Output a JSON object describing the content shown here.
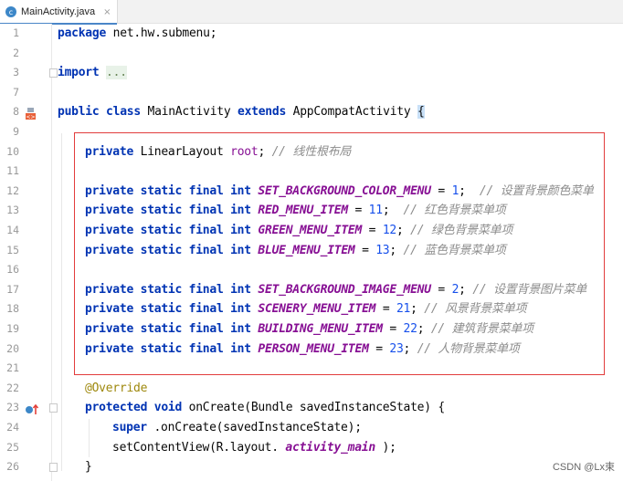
{
  "tab": {
    "icon_letter": "c",
    "filename": "MainActivity.java",
    "close": "×"
  },
  "lines": [
    {
      "n": "1",
      "parts": [
        [
          "kw",
          "package"
        ],
        [
          "",
          "net.hw.submenu;"
        ]
      ]
    },
    {
      "n": "2",
      "parts": []
    },
    {
      "n": "3",
      "parts": [
        [
          "kw",
          "import"
        ],
        [
          "",
          ""
        ],
        [
          "fold",
          "..."
        ]
      ]
    },
    {
      "n": "7",
      "parts": []
    },
    {
      "n": "8",
      "parts": [
        [
          "kw",
          "public class"
        ],
        [
          "",
          "MainActivity"
        ],
        [
          "kw",
          "extends"
        ],
        [
          "",
          "AppCompatActivity"
        ],
        [
          "brace",
          "{"
        ]
      ]
    },
    {
      "n": "9",
      "parts": []
    },
    {
      "n": "10",
      "parts": [
        [
          "kw",
          "private"
        ],
        [
          "",
          "LinearLayout"
        ],
        [
          "fld",
          "root"
        ],
        [
          "",
          ";"
        ],
        [
          "cm",
          "// 线性根布局"
        ]
      ]
    },
    {
      "n": "11",
      "parts": []
    },
    {
      "n": "12",
      "parts": [
        [
          "kw",
          "private static final int"
        ],
        [
          "cst",
          "SET_BACKGROUND_COLOR_MENU"
        ],
        [
          "",
          "="
        ],
        [
          "num",
          "1"
        ],
        [
          "",
          ";"
        ],
        [
          "cm",
          "// 设置背景颜色菜单"
        ]
      ]
    },
    {
      "n": "13",
      "parts": [
        [
          "kw",
          "private static final int"
        ],
        [
          "cst",
          "RED_MENU_ITEM"
        ],
        [
          "",
          "="
        ],
        [
          "num",
          "11"
        ],
        [
          "",
          ";"
        ],
        [
          "cm",
          "// 红色背景菜单项"
        ]
      ]
    },
    {
      "n": "14",
      "parts": [
        [
          "kw",
          "private static final int"
        ],
        [
          "cst",
          "GREEN_MENU_ITEM"
        ],
        [
          "",
          "="
        ],
        [
          "num",
          "12"
        ],
        [
          "",
          ";"
        ],
        [
          "cm",
          "// 绿色背景菜单项"
        ]
      ]
    },
    {
      "n": "15",
      "parts": [
        [
          "kw",
          "private static final int"
        ],
        [
          "cst",
          "BLUE_MENU_ITEM"
        ],
        [
          "",
          "="
        ],
        [
          "num",
          "13"
        ],
        [
          "",
          ";"
        ],
        [
          "cm",
          "// 蓝色背景菜单项"
        ]
      ]
    },
    {
      "n": "16",
      "parts": []
    },
    {
      "n": "17",
      "parts": [
        [
          "kw",
          "private static final int"
        ],
        [
          "cst",
          "SET_BACKGROUND_IMAGE_MENU"
        ],
        [
          "",
          "="
        ],
        [
          "num",
          "2"
        ],
        [
          "",
          ";"
        ],
        [
          "cm",
          "// 设置背景图片菜单"
        ]
      ]
    },
    {
      "n": "18",
      "parts": [
        [
          "kw",
          "private static final int"
        ],
        [
          "cst",
          "SCENERY_MENU_ITEM"
        ],
        [
          "",
          "="
        ],
        [
          "num",
          "21"
        ],
        [
          "",
          ";"
        ],
        [
          "cm",
          "// 风景背景菜单项"
        ]
      ]
    },
    {
      "n": "19",
      "parts": [
        [
          "kw",
          "private static final int"
        ],
        [
          "cst",
          "BUILDING_MENU_ITEM"
        ],
        [
          "",
          "="
        ],
        [
          "num",
          "22"
        ],
        [
          "",
          ";"
        ],
        [
          "cm",
          "// 建筑背景菜单项"
        ]
      ]
    },
    {
      "n": "20",
      "parts": [
        [
          "kw",
          "private static final int"
        ],
        [
          "cst",
          "PERSON_MENU_ITEM"
        ],
        [
          "",
          "="
        ],
        [
          "num",
          "23"
        ],
        [
          "",
          ";"
        ],
        [
          "cm",
          "// 人物背景菜单项"
        ]
      ]
    },
    {
      "n": "21",
      "parts": []
    },
    {
      "n": "22",
      "parts": [
        [
          "ann",
          "@Override"
        ]
      ]
    },
    {
      "n": "23",
      "parts": [
        [
          "kw",
          "protected void"
        ],
        [
          "",
          "onCreate(Bundle savedInstanceState) {"
        ]
      ]
    },
    {
      "n": "24",
      "parts": [
        [
          "kw",
          "super"
        ],
        [
          "",
          ".onCreate(savedInstanceState);"
        ]
      ]
    },
    {
      "n": "25",
      "parts": [
        [
          "",
          "setContentView(R.layout."
        ],
        [
          "cst",
          "activity_main"
        ],
        [
          "",
          ");"
        ]
      ]
    },
    {
      "n": "26",
      "parts": [
        [
          "",
          "}"
        ]
      ]
    }
  ],
  "watermark": "CSDN @Lx束"
}
